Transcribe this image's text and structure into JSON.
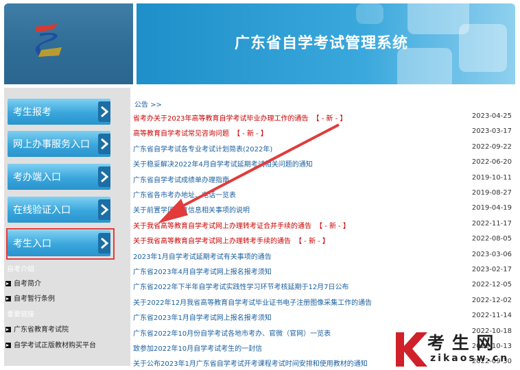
{
  "header": {
    "title": "广东省自学考试管理系统"
  },
  "sidebar": {
    "nav": [
      {
        "label": "考生报考"
      },
      {
        "label": "网上办事服务入口"
      },
      {
        "label": "考办端入口"
      },
      {
        "label": "在线验证入口"
      },
      {
        "label": "考生入口"
      }
    ],
    "section1": {
      "heading": "自考介绍",
      "links": [
        "自考简介",
        "自考暂行条例"
      ]
    },
    "section2": {
      "heading": "重要链接",
      "links": [
        "广东省教育考试院",
        "自学考试正版教材购买平台"
      ]
    }
  },
  "notice": {
    "header": "公告 >>",
    "new_tag": "【 - 新 - 】",
    "items": [
      {
        "title": "省考办关于2023年高等教育自学考试毕业办理工作的通告",
        "date": "2023-04-25",
        "red": true,
        "new": true
      },
      {
        "title": "高等教育自学考试常见咨询问题",
        "date": "2023-03-17",
        "red": true,
        "new": true
      },
      {
        "title": "广东省自学考试各专业考试计划简表(2022年)",
        "date": "2022-09-22",
        "red": false,
        "new": false
      },
      {
        "title": "关于稳妥解决2022年4月自学考试延期考试相关问题的通知",
        "date": "2022-06-20",
        "red": false,
        "new": false
      },
      {
        "title": "广东省自学考试成绩单办理指南",
        "date": "2019-10-11",
        "red": false,
        "new": false
      },
      {
        "title": "广东省各市考办地址、电话一览表",
        "date": "2019-08-27",
        "red": false,
        "new": false
      },
      {
        "title": "关于前置学历教育信息相关事项的说明",
        "date": "2019-04-19",
        "red": false,
        "new": false
      },
      {
        "title": "关于我省高等教育自学考试网上办理转考证合并手续的通告",
        "date": "2022-11-17",
        "red": true,
        "new": true
      },
      {
        "title": "关于我省高等教育自学考试网上办理转考手续的通告",
        "date": "2022-08-05",
        "red": true,
        "new": true
      },
      {
        "title": "2023年1月自学考试延期考试有关事项的通告",
        "date": "2023-03-06",
        "red": false,
        "new": false
      },
      {
        "title": "广东省2023年4月自学考试网上报名报考须知",
        "date": "2023-02-17",
        "red": false,
        "new": false
      },
      {
        "title": "广东省2022年下半年自学考试实践性学习环节考核延期于12月7日公布",
        "date": "2022-12-05",
        "red": false,
        "new": false
      },
      {
        "title": "关于2022年12月我省高等教育自学考试毕业证书电子注册图像采集工作的通告",
        "date": "2022-12-02",
        "red": false,
        "new": false
      },
      {
        "title": "广东省2023年1月自学考试网上报名报考须知",
        "date": "2022-11-14",
        "red": false,
        "new": false
      },
      {
        "title": "广东省2022年10月份自学考试各地市考办、官微（官网）一览表",
        "date": "2022-10-18",
        "red": false,
        "new": false
      },
      {
        "title": "致参加2022年10月自学考试考生的一封信",
        "date": "2022-10-13",
        "red": false,
        "new": false
      },
      {
        "title": "关于公布2023年1月广东省自学考试开考课程考试时间安排和使用教材的通知",
        "date": "2022-09-30",
        "red": false,
        "new": false
      }
    ]
  },
  "watermark": {
    "brand": "考 生 网",
    "domain": "zikaosw.cn",
    "letter": "K"
  },
  "colors": {
    "nav_blue": "#39a6dc",
    "link_blue": "#1a5fa0",
    "alert_red": "#cc0000",
    "highlight_red": "#e23b3b"
  }
}
